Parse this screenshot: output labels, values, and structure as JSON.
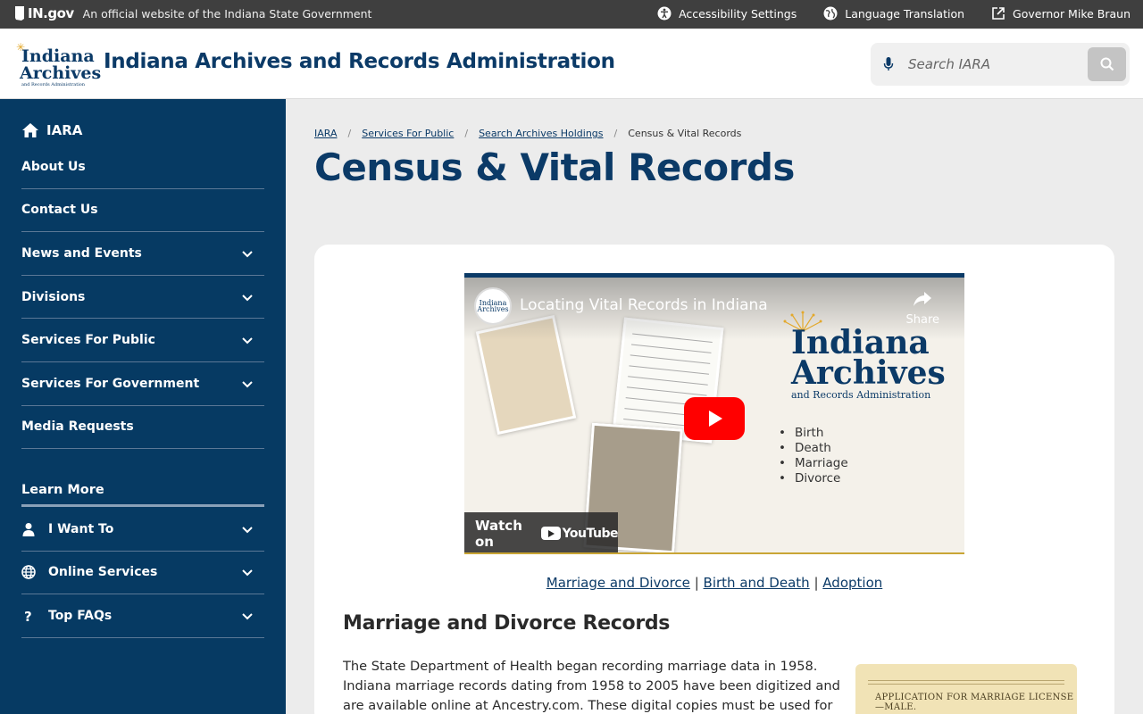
{
  "topbar": {
    "brand": "IN.gov",
    "official_text": "An official website of the Indiana State Government",
    "accessibility": "Accessibility Settings",
    "language": "Language Translation",
    "governor": "Governor Mike Braun"
  },
  "header": {
    "logo_line1": "Indiana",
    "logo_line2": "Archives",
    "logo_line3": "and Records Administration",
    "title": "Indiana Archives and Records Administration",
    "search_placeholder": "Search IARA"
  },
  "sidebar": {
    "home_label": "IARA",
    "items": [
      {
        "label": "About Us"
      },
      {
        "label": "Contact Us"
      },
      {
        "label": "News and Events"
      },
      {
        "label": "Divisions"
      },
      {
        "label": "Services For Public"
      },
      {
        "label": "Services For Government"
      },
      {
        "label": "Media Requests"
      }
    ],
    "learn_more": "Learn More",
    "learn_items": [
      {
        "label": "I Want To"
      },
      {
        "label": "Online Services"
      },
      {
        "label": "Top FAQs"
      }
    ]
  },
  "breadcrumb": {
    "items": [
      "IARA",
      "Services For Public",
      "Search Archives Holdings"
    ],
    "current": "Census & Vital Records",
    "sep": "/"
  },
  "page": {
    "title": "Census & Vital Records"
  },
  "video": {
    "channel_line1": "Indiana",
    "channel_line2": "Archives",
    "title": "Locating Vital Records in Indiana",
    "share": "Share",
    "logo_a": "Indiana",
    "logo_b": "Archives",
    "logo_c": "and Records Administration",
    "bullets": [
      "Birth",
      "Death",
      "Marriage",
      "Divorce"
    ],
    "watch_on": "Watch on",
    "youtube": "YouTube"
  },
  "links": {
    "marriage": "Marriage and Divorce",
    "birth": "Birth and Death",
    "adoption": "Adoption",
    "sep": "|"
  },
  "section": {
    "heading": "Marriage and Divorce Records",
    "body": "The State Department of Health began recording marriage data in 1958. Indiana marriage records dating from 1958 to 2005 have been digitized and are available online at Ancestry.com. These digital copies must be used for",
    "image_text": "APPLICATION FOR MARRIAGE LICENSE—MALE."
  }
}
